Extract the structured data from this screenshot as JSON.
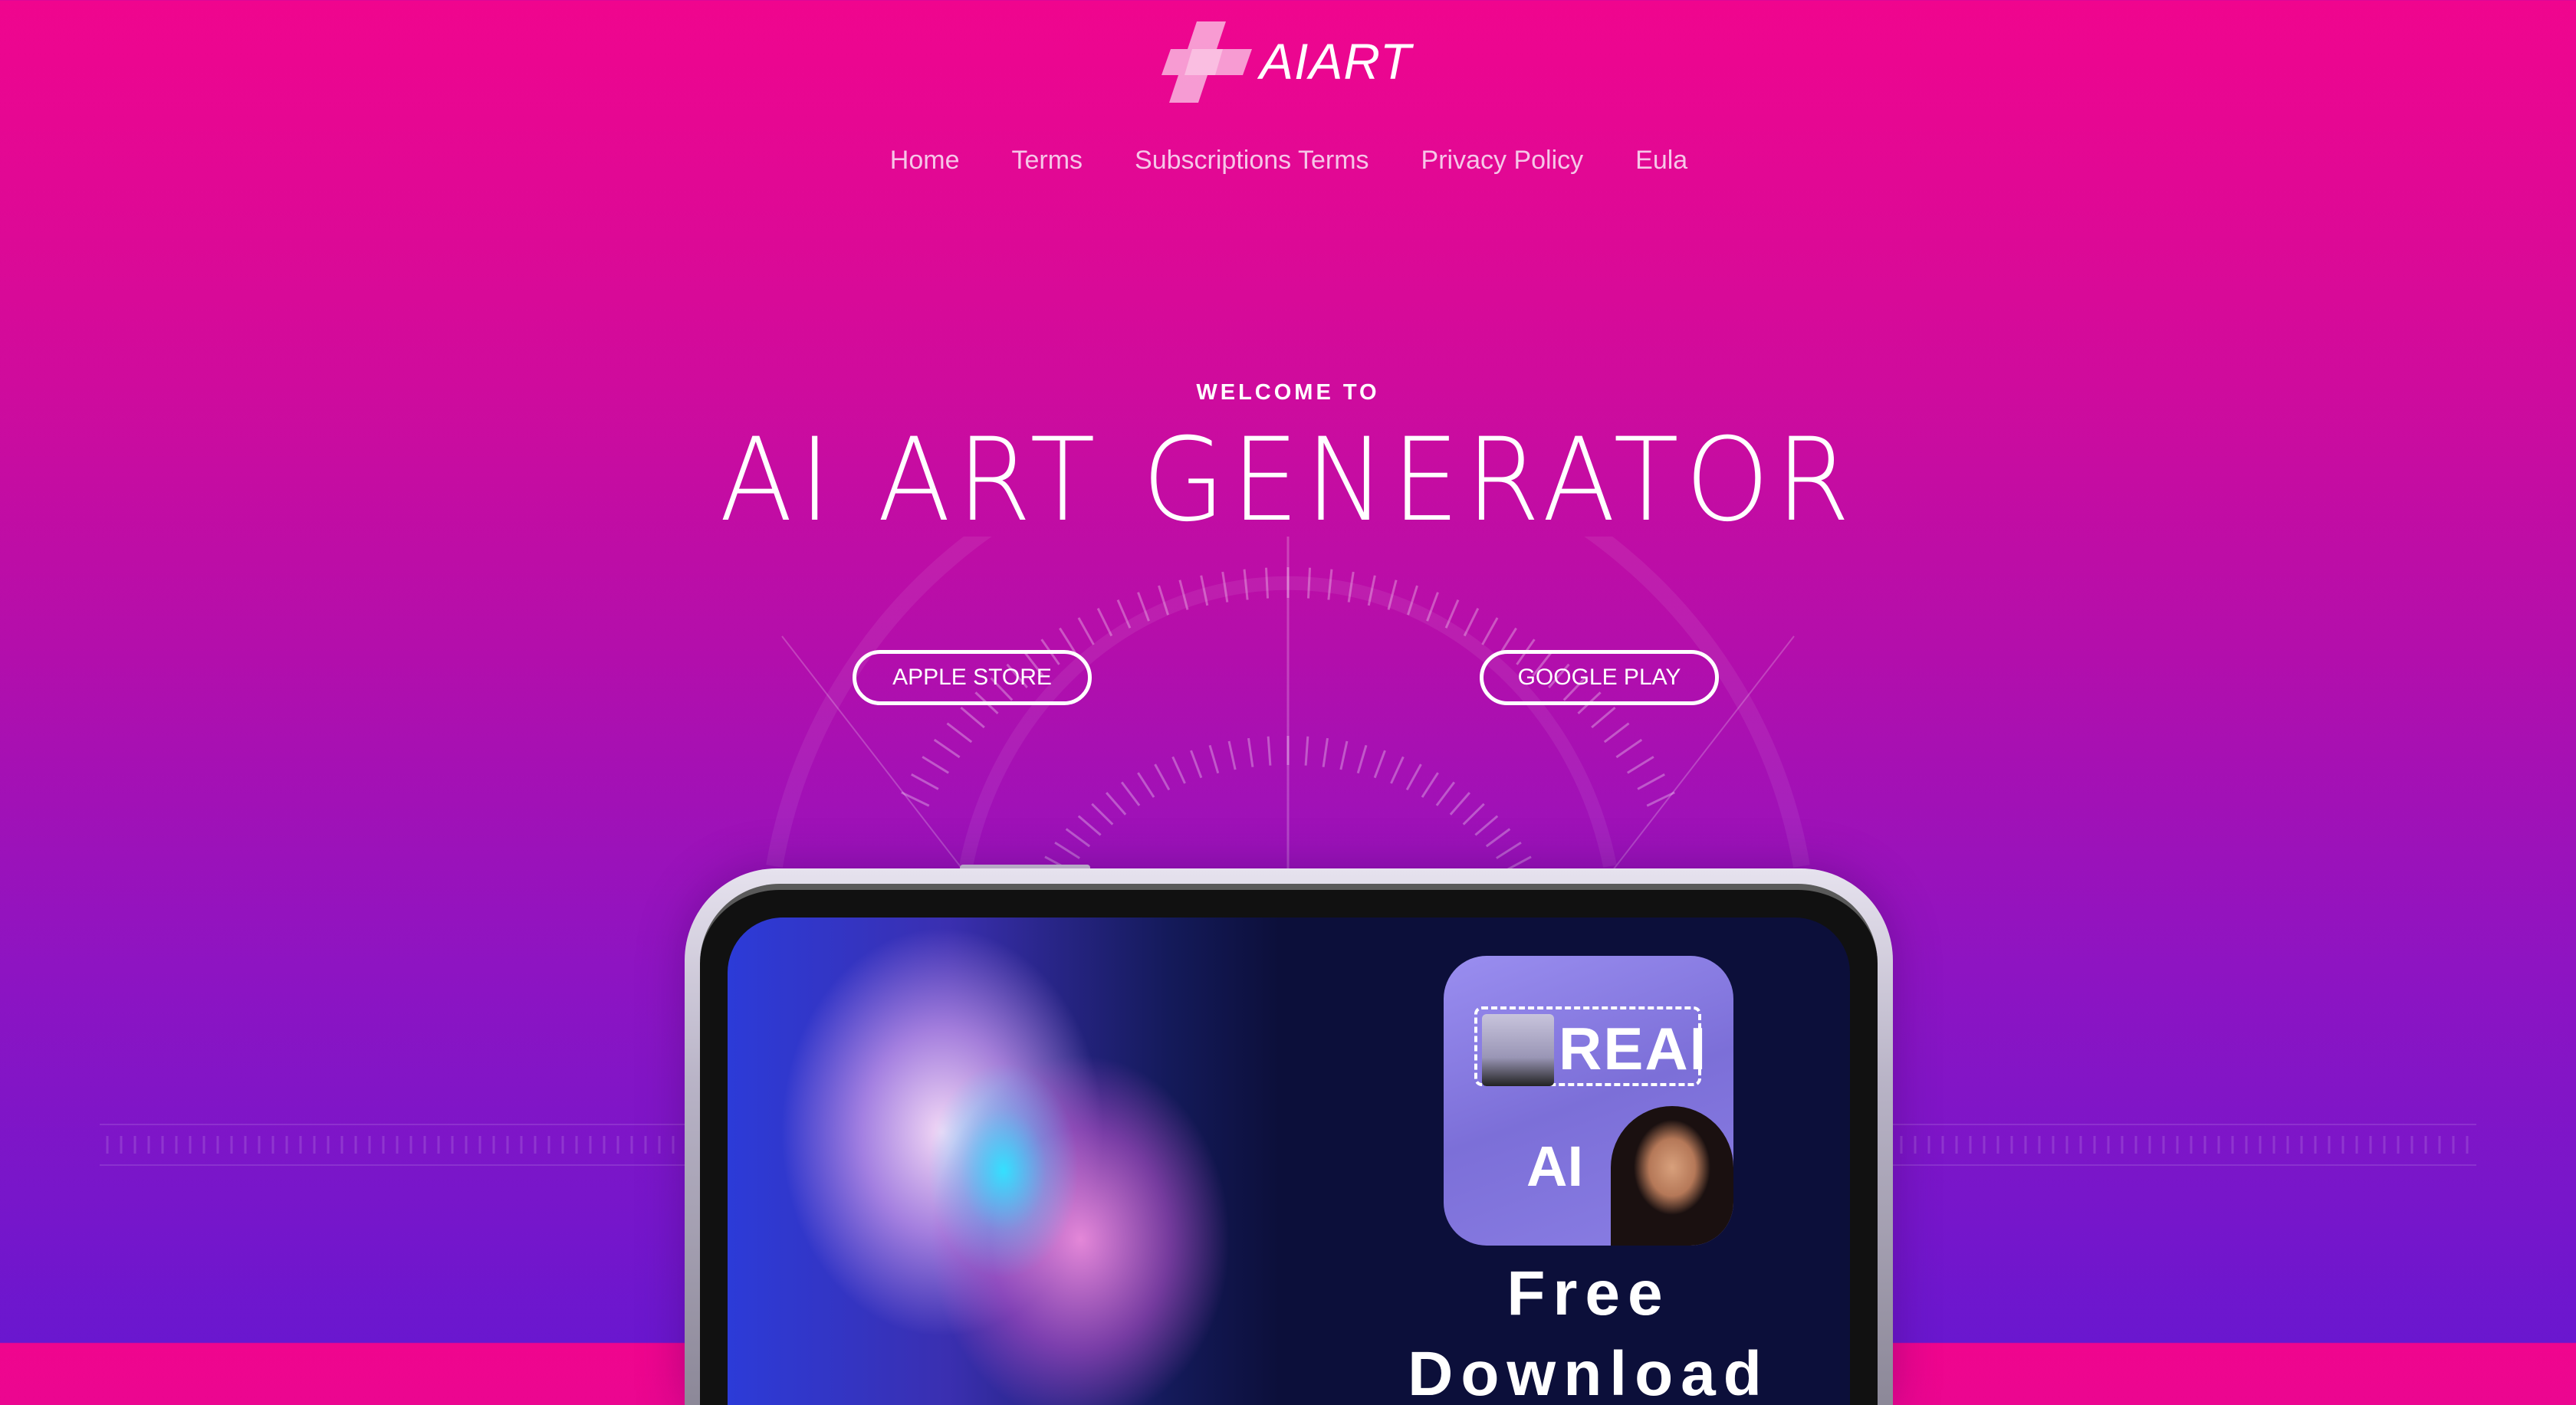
{
  "brand": {
    "logo_text": "AIART",
    "logo_icon": "plus-cross-icon"
  },
  "nav": {
    "items": [
      {
        "label": "Home"
      },
      {
        "label": "Terms"
      },
      {
        "label": "Subscriptions Terms"
      },
      {
        "label": "Privacy Policy"
      },
      {
        "label": "Eula"
      }
    ]
  },
  "hero": {
    "eyebrow": "WELCOME TO",
    "title": "AI ART GENERATOR",
    "buttons": {
      "apple": "APPLE STORE",
      "google": "GOOGLE PLAY"
    }
  },
  "phone_screen": {
    "app_icon_text_top": "REAI",
    "app_icon_text_bottom": "AI",
    "promo_line1": "Free",
    "promo_line2": "Download"
  },
  "colors": {
    "bg_top": "#f0058e",
    "bg_bottom": "#6a17cf",
    "text": "#ffffff",
    "nav_text": "#f6c6e8",
    "screen_bg": "#0c0f3a"
  }
}
